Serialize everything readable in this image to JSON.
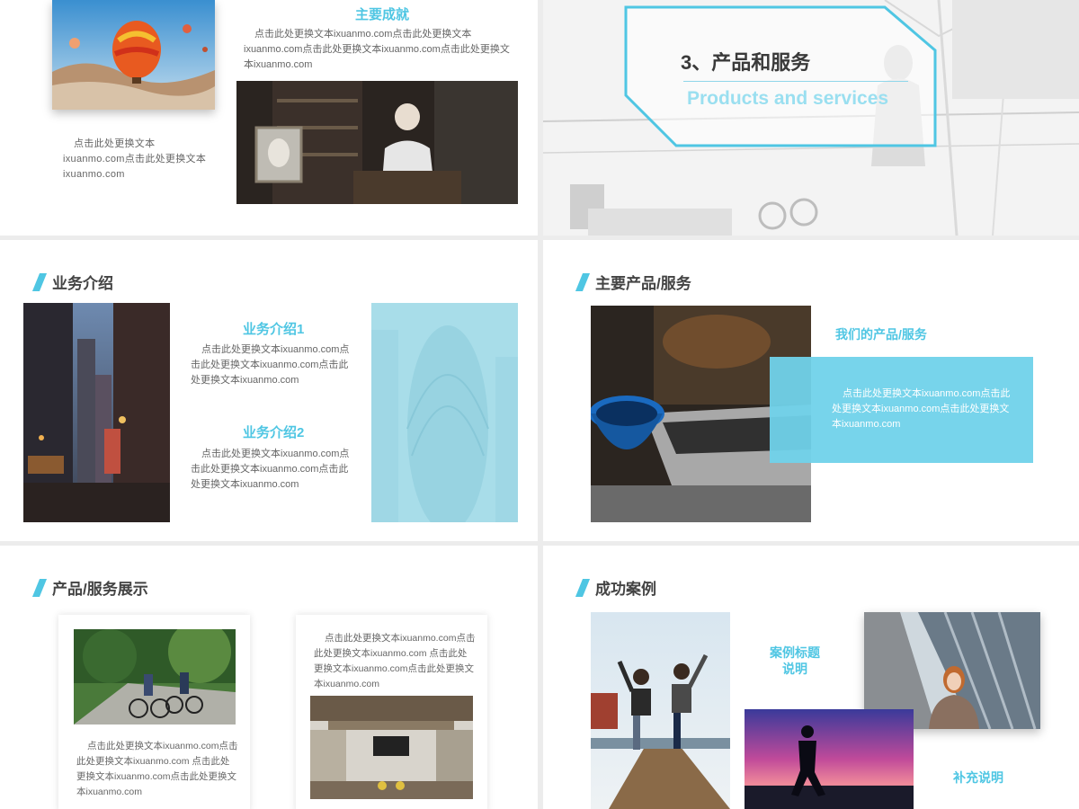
{
  "slide1": {
    "heading": "主要成就",
    "text_right": "点击此处更换文本ixuanmo.com点击此处更换文本ixuanmo.com点击此处更换文本ixuanmo.com点击此处更换文本ixuanmo.com",
    "text_left": "点击此处更换文本ixuanmo.com点击此处更换文本ixuanmo.com"
  },
  "slide2": {
    "title_cn": "3、产品和服务",
    "title_en": "Products and services"
  },
  "slide3": {
    "title": "业务介绍",
    "item1_title": "业务介绍1",
    "item1_text": "点击此处更换文本ixuanmo.com点击此处更换文本ixuanmo.com点击此处更换文本ixuanmo.com",
    "item2_title": "业务介绍2",
    "item2_text": "点击此处更换文本ixuanmo.com点击此处更换文本ixuanmo.com点击此处更换文本ixuanmo.com"
  },
  "slide4": {
    "title": "主要产品/服务",
    "subtitle": "我们的产品/服务",
    "box_text": "点击此处更换文本ixuanmo.com点击此处更换文本ixuanmo.com点击此处更换文本ixuanmo.com"
  },
  "slide5": {
    "title": "产品/服务展示",
    "card1_text": "点击此处更换文本ixuanmo.com点击此处更换文本ixuanmo.com 点击此处更换文本ixuanmo.com点击此处更换文本ixuanmo.com",
    "card2_text": "点击此处更换文本ixuanmo.com点击此处更换文本ixuanmo.com 点击此处更换文本ixuanmo.com点击此处更换文本ixuanmo.com"
  },
  "slide6": {
    "title": "成功案例",
    "case_title_line1": "案例标题",
    "case_title_line2": "说明",
    "supplement": "补充说明"
  },
  "colors": {
    "accent": "#4fc6e3",
    "light_accent": "#a8dde9",
    "box_accent": "#7fd6ec"
  }
}
